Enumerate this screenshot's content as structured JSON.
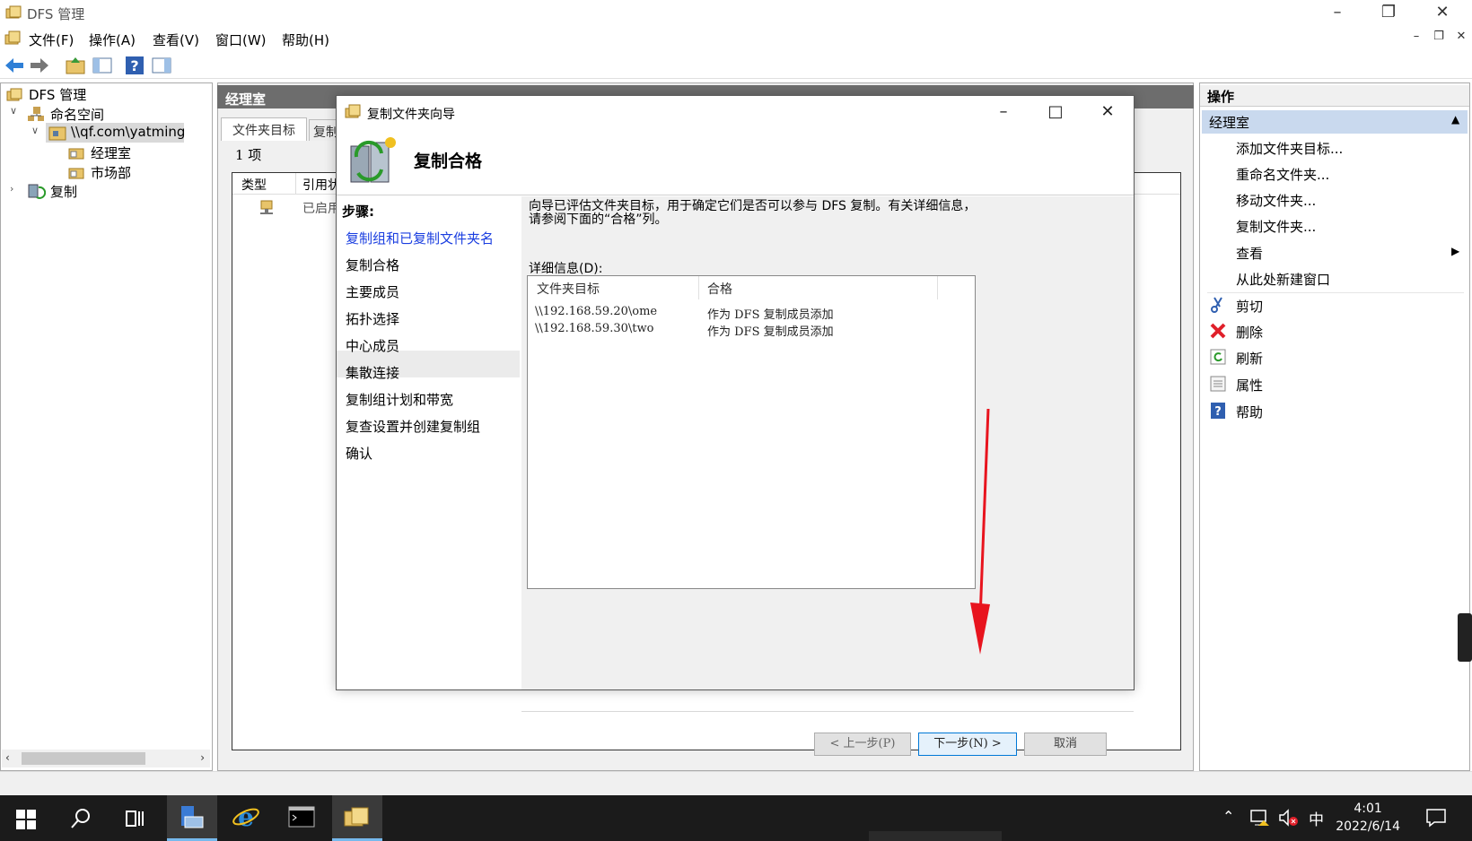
{
  "window": {
    "title": "DFS 管理"
  },
  "menu": [
    "文件(F)",
    "操作(A)",
    "查看(V)",
    "窗口(W)",
    "帮助(H)"
  ],
  "tree": {
    "root": "DFS 管理",
    "namespace": "命名空间",
    "ns_path": "\\\\qf.com\\yatming",
    "children": [
      "经理室",
      "市场部"
    ],
    "replication": "复制"
  },
  "center": {
    "header": "经理室",
    "tabs": [
      "文件夹目标",
      "复制"
    ],
    "count": "1 项",
    "columns": [
      "类型",
      "引用状"
    ],
    "row_status": "已启用"
  },
  "actions": {
    "header": "操作",
    "section": "经理室",
    "items": [
      "添加文件夹目标...",
      "重命名文件夹...",
      "移动文件夹...",
      "复制文件夹...",
      "查看",
      "从此处新建窗口",
      "剪切",
      "删除",
      "刷新",
      "属性",
      "帮助"
    ]
  },
  "dialog": {
    "title": "复制文件夹向导",
    "heading": "复制合格",
    "steps_label": "步骤:",
    "steps": [
      "复制组和已复制文件夹名",
      "复制合格",
      "主要成员",
      "拓扑选择",
      "中心成员",
      "集散连接",
      "复制组计划和带宽",
      "复查设置并创建复制组",
      "确认"
    ],
    "description": "向导已评估文件夹目标，用于确定它们是否可以参与 DFS 复制。有关详细信息，请参阅下面的“合格”列。",
    "details_label": "详细信息(D):",
    "columns": [
      "文件夹目标",
      "合格"
    ],
    "rows": [
      {
        "target": "\\\\192.168.59.20\\ome",
        "eligibility": "作为 DFS 复制成员添加"
      },
      {
        "target": "\\\\192.168.59.30\\two",
        "eligibility": "作为 DFS 复制成员添加"
      }
    ],
    "buttons": {
      "back": "< 上一步(P)",
      "next": "下一步(N) >",
      "cancel": "取消"
    }
  },
  "taskbar": {
    "time": "4:01",
    "date": "2022/6/14",
    "ime": "中"
  }
}
